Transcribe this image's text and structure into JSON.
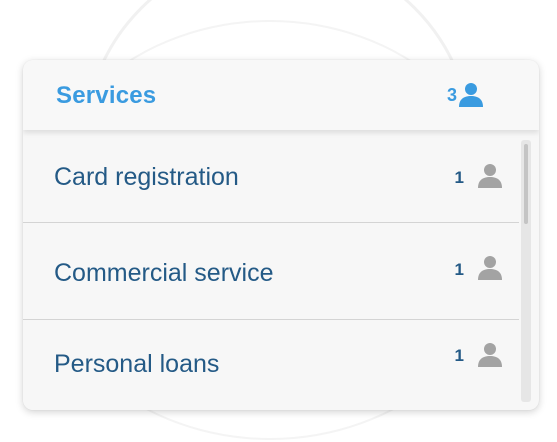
{
  "header": {
    "title": "Services",
    "count": "3",
    "icon": "person-icon",
    "accent_color": "#3a9be0"
  },
  "services": [
    {
      "label": "Card registration",
      "count": "1",
      "icon": "person-icon"
    },
    {
      "label": "Commercial service",
      "count": "1",
      "icon": "person-icon"
    },
    {
      "label": "Personal loans",
      "count": "1",
      "icon": "person-icon"
    }
  ],
  "colors": {
    "item_text": "#245a86",
    "item_icon": "#a3a3a3",
    "panel_background": "#f7f7f7"
  }
}
